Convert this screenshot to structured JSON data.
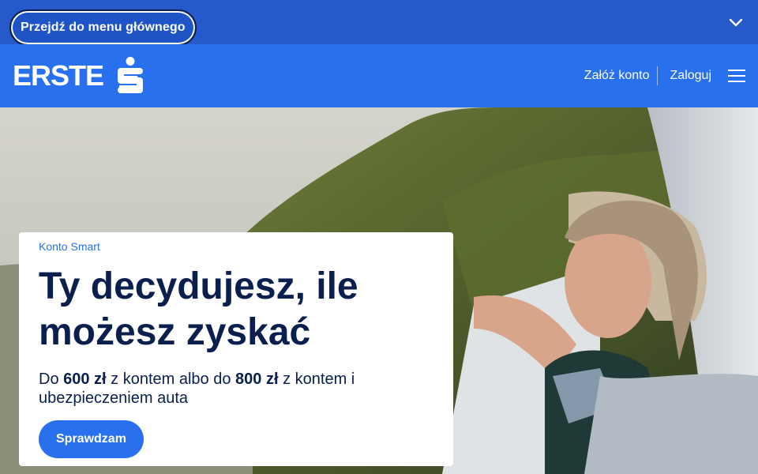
{
  "skip_link": "Przejdź do menu głównego",
  "header": {
    "logo_text": "ERSTE",
    "open_account": "Załóż konto",
    "login": "Zaloguj"
  },
  "icons": {
    "top_chevron": "chevron-down-icon",
    "logo_mark": "erste-s-logo",
    "menu": "hamburger-menu-icon"
  },
  "hero": {
    "eyebrow": "Konto Smart",
    "headline": "Ty decydujesz, ile możesz zyskać",
    "desc_1": "Do ",
    "amount_1": "600 zł",
    "desc_2": " z kontem albo do ",
    "amount_2": "800 zł",
    "desc_3": " z kontem i ubezpieczeniem auta",
    "cta": "Sprawdzam"
  },
  "colors": {
    "skip_bar": "#2659c9",
    "header": "#2870ed",
    "navy_text": "#0b1f4f",
    "accent": "#2870ed"
  }
}
